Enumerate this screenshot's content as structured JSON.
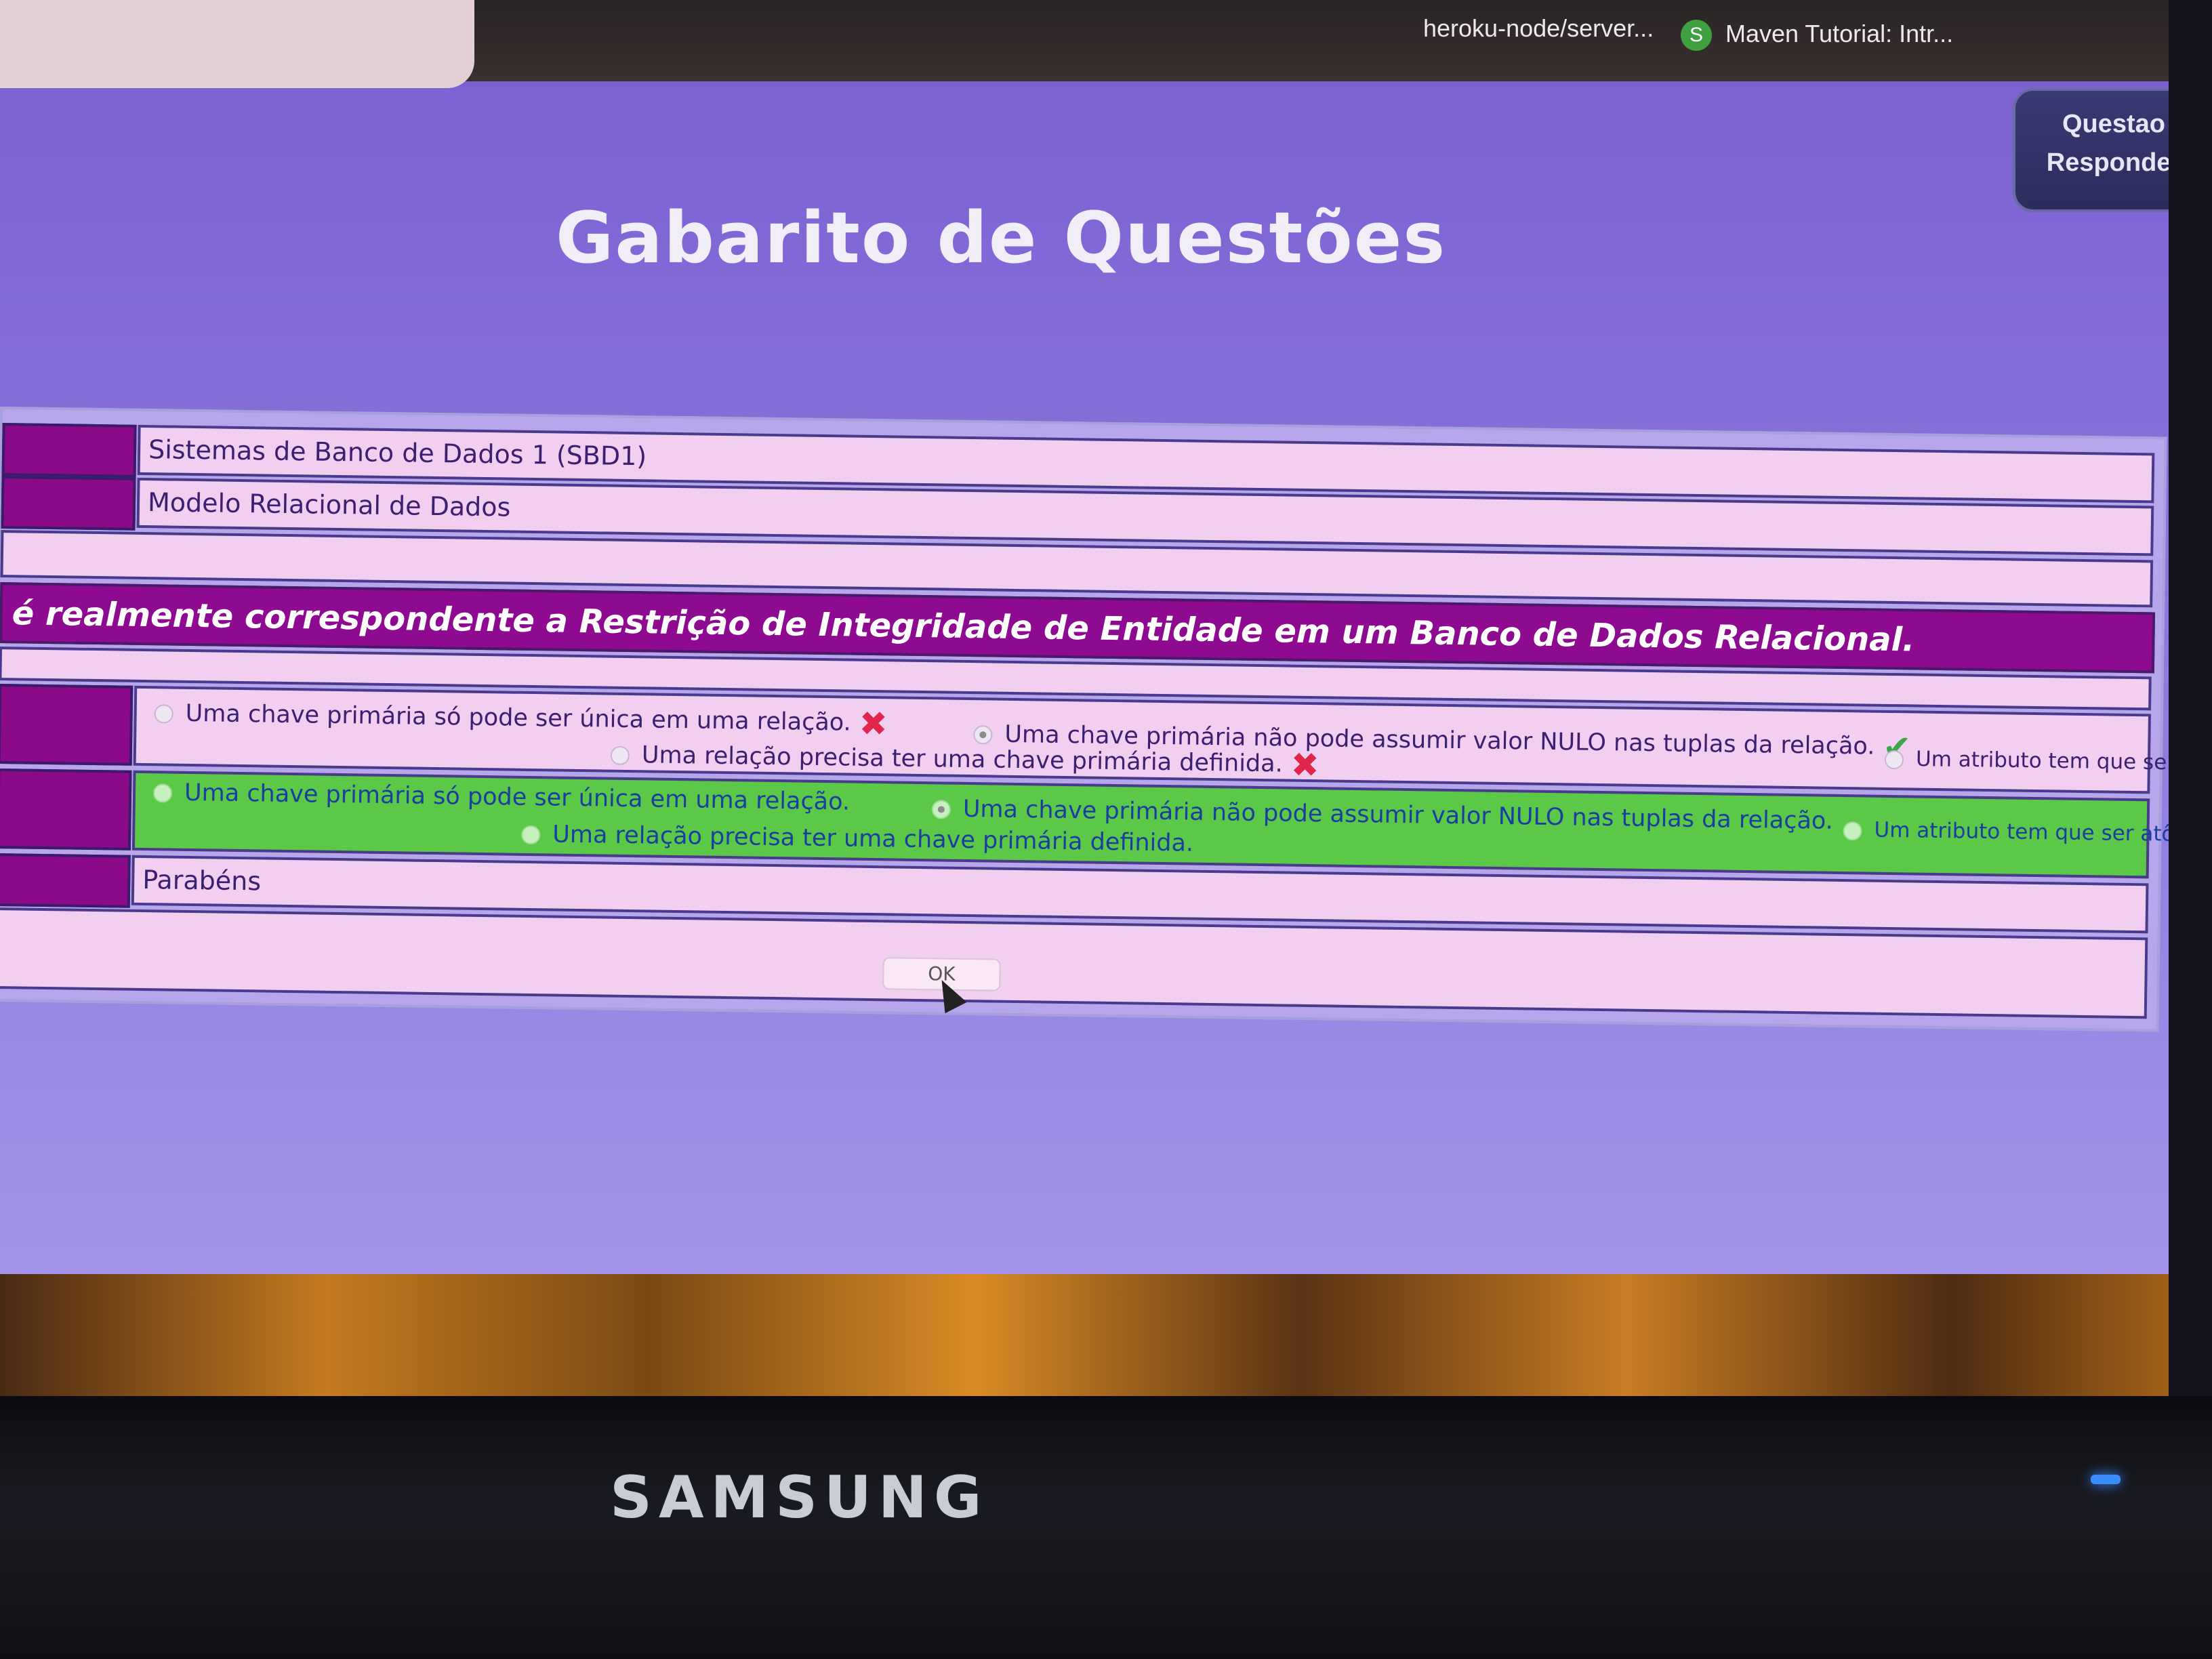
{
  "browser": {
    "address_text": "",
    "bookmarks": [
      {
        "label": "heroku-node/server...",
        "icon": ""
      },
      {
        "label": "Maven Tutorial: Intr...",
        "icon": "maven-icon"
      }
    ],
    "overflow": "»"
  },
  "nav": {
    "questao": "Questao",
    "responder": "Responder"
  },
  "page": {
    "title": "Gabarito de Questões"
  },
  "gabarito": {
    "disciplina": "Sistemas de Banco de Dados 1 (SBD1)",
    "assunto": "Modelo Relacional de Dados",
    "question": "é realmente correspondente a Restrição de Integridade de Entidade em um Banco de Dados Relacional.",
    "chosen_options": [
      {
        "text": "Uma chave primária só pode ser única em uma relação.",
        "selected": false,
        "mark": "wrong"
      },
      {
        "text": "Uma chave primária não pode assumir valor NULO nas tuplas da relação.",
        "selected": true,
        "mark": "right"
      },
      {
        "text": "Um atributo tem que ser atômico em uma relação.",
        "selected": false,
        "mark": "wrong"
      },
      {
        "text": "Uma relação precisa ter uma chave primária definida.",
        "selected": false,
        "mark": "wrong"
      }
    ],
    "answer_options": [
      {
        "text": "Uma chave primária só pode ser única em uma relação.",
        "selected": false
      },
      {
        "text": "Uma chave primária não pode assumir valor NULO nas tuplas da relação.",
        "selected": true
      },
      {
        "text": "Um atributo tem que ser atômico em uma relação.",
        "selected": false
      },
      {
        "text": "Uma relação precisa ter uma chave primária definida.",
        "selected": false
      }
    ],
    "result": "Parabéns",
    "ok_label": "OK"
  },
  "monitor": {
    "brand": "SAMSUNG"
  },
  "colors": {
    "background": "#8a74dc",
    "header_cell": "#8a0a8a",
    "value_cell": "#f2cef0",
    "answer_highlight": "#5cc848",
    "wrong_mark": "#e0264a",
    "right_mark": "#3aa84a"
  },
  "icons": {
    "wrong": "✖",
    "right": "✔",
    "maven": "S"
  }
}
